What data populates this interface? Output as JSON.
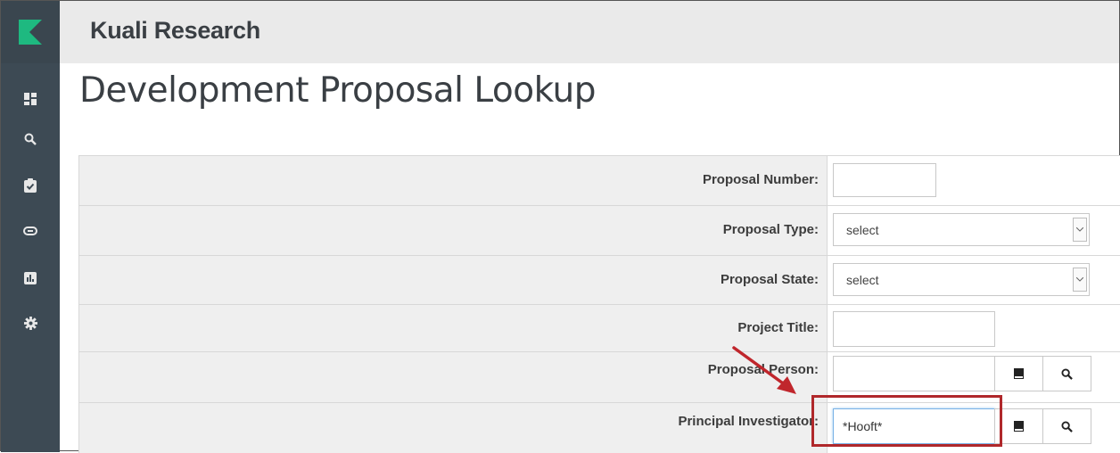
{
  "app": {
    "title": "Kuali Research"
  },
  "sidebar": {
    "items": [
      {
        "icon": "dashboard-icon"
      },
      {
        "icon": "search-icon"
      },
      {
        "icon": "clipboard-check-icon"
      },
      {
        "icon": "link-icon"
      },
      {
        "icon": "report-chart-icon"
      },
      {
        "icon": "gear-icon"
      }
    ]
  },
  "page": {
    "title": "Development Proposal Lookup"
  },
  "form": {
    "proposal_number": {
      "label": "Proposal Number:",
      "value": ""
    },
    "proposal_type": {
      "label": "Proposal Type:",
      "selected": "select"
    },
    "proposal_state": {
      "label": "Proposal State:",
      "selected": "select"
    },
    "project_title": {
      "label": "Project Title:",
      "value": ""
    },
    "proposal_person": {
      "label": "Proposal Person:",
      "value": ""
    },
    "principal_investigator": {
      "label": "Principal Investigator:",
      "value": "*Hooft*"
    }
  },
  "colors": {
    "sidebar": "#3d4a54",
    "brand_green": "#1eb980",
    "highlight": "#b0282b"
  }
}
